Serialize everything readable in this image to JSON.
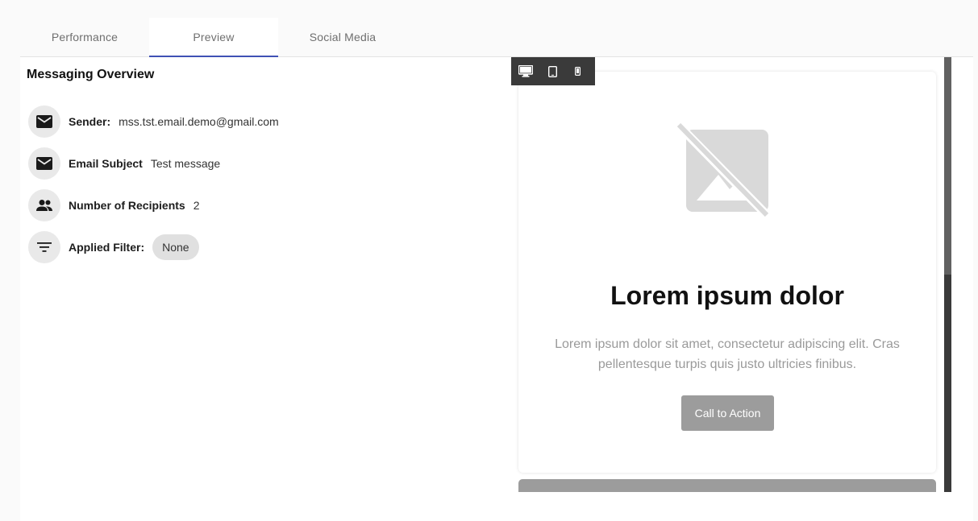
{
  "tabs": [
    {
      "label": "Performance",
      "active": false
    },
    {
      "label": "Preview",
      "active": true
    },
    {
      "label": "Social Media",
      "active": false
    }
  ],
  "overview": {
    "title": "Messaging Overview",
    "sender": {
      "label": "Sender:",
      "value": "mss.tst.email.demo@gmail.com",
      "icon": "mail-icon"
    },
    "subject": {
      "label": "Email Subject",
      "value": "Test message",
      "icon": "mail-icon"
    },
    "recipients": {
      "label": "Number of Recipients",
      "value": "2",
      "icon": "people-icon"
    },
    "filter": {
      "label": "Applied Filter:",
      "value": "None",
      "icon": "filter-icon"
    }
  },
  "preview": {
    "device_buttons": [
      "desktop-icon",
      "tablet-icon",
      "phone-icon"
    ],
    "email": {
      "image_icon": "image-not-supported-icon",
      "heading": "Lorem ipsum dolor",
      "body": "Lorem ipsum dolor sit amet, consectetur adipiscing elit. Cras pellentesque turpis quis justo ultricies finibus.",
      "cta_label": "Call to Action"
    }
  },
  "colors": {
    "accent": "#3f51b5",
    "device_bar": "#3a3a3a",
    "cta": "#9c9c9c"
  }
}
